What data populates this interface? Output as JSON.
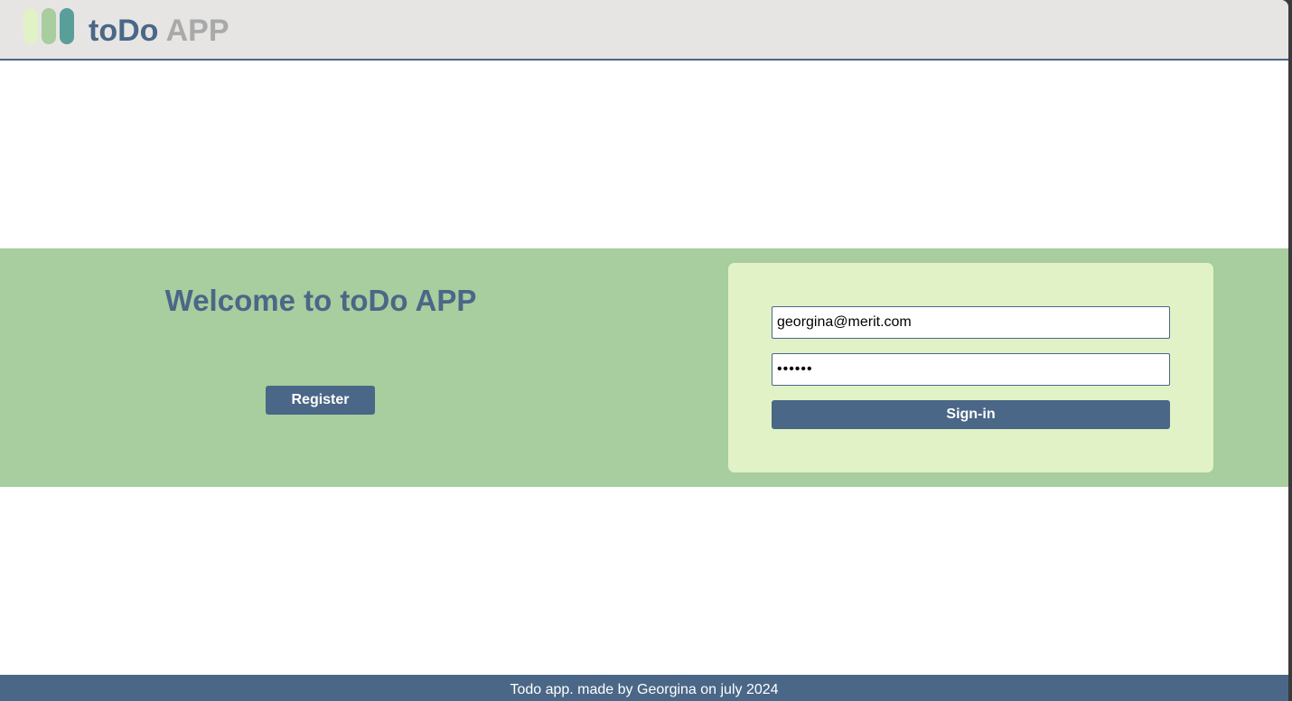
{
  "header": {
    "brand_primary": "toDo",
    "brand_secondary": "APP",
    "logo_icon": "three-pill-bars-logo",
    "colors": {
      "background": "#e6e5e4",
      "brand_primary": "#4a6787",
      "brand_secondary": "#a9a9a9",
      "logo_bars": [
        "#e0f2c6",
        "#a8cd9e",
        "#5a9e9a"
      ]
    }
  },
  "hero": {
    "welcome_title": "Welcome to toDo APP",
    "register_label": "Register",
    "background_color": "#a8cd9e"
  },
  "login": {
    "email_value": "georgina@merit.com",
    "password_value": "••••••",
    "signin_label": "Sign-in",
    "card_color": "#e0f2c6",
    "accent_color": "#4a6787"
  },
  "footer": {
    "text": "Todo app. made by Georgina on july 2024"
  }
}
